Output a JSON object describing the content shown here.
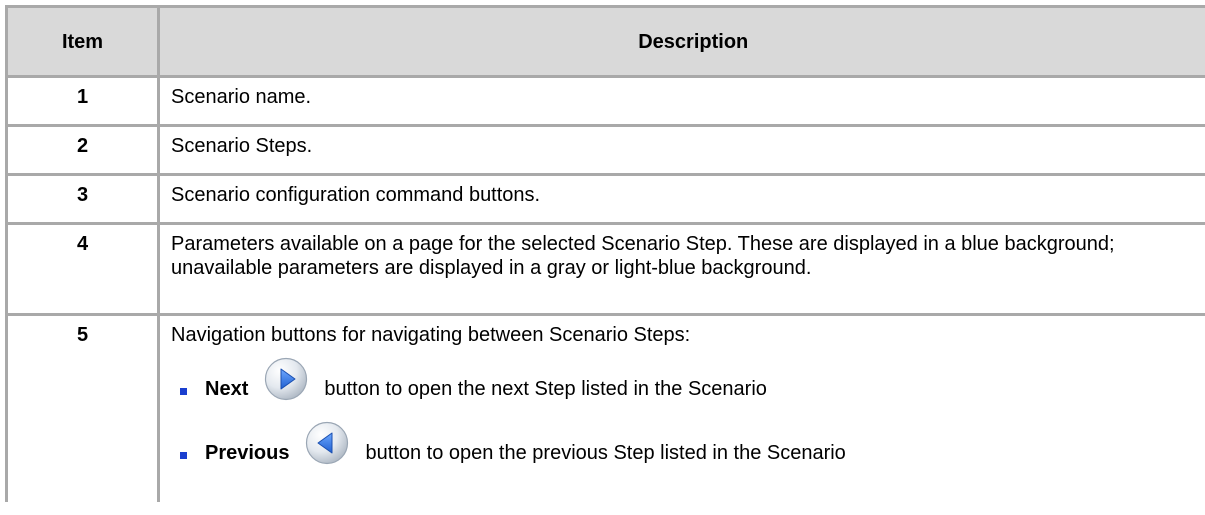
{
  "table": {
    "header": {
      "item": "Item",
      "description": "Description"
    },
    "rows": [
      {
        "item": "1",
        "description": "Scenario name."
      },
      {
        "item": "2",
        "description": "Scenario Steps."
      },
      {
        "item": "3",
        "description": "Scenario configuration command buttons."
      },
      {
        "item": "4",
        "description": "Parameters available on a page for the selected Scenario Step. These are displayed in a blue background; unavailable parameters are displayed in a gray or light-blue background."
      },
      {
        "item": "5",
        "description": "Navigation buttons for navigating between Scenario Steps:",
        "bullets": [
          {
            "label": "Next",
            "icon": "next-arrow-icon",
            "text": "button to open the next Step listed in the Scenario"
          },
          {
            "label": "Previous",
            "icon": "previous-arrow-icon",
            "text": "button to open the previous Step listed in the Scenario"
          }
        ]
      }
    ]
  },
  "colors": {
    "header_bg": "#d9d9d9",
    "border": "#a9a9a9",
    "bullet": "#1a3fcf",
    "icon_blue": "#2f6fd6"
  }
}
